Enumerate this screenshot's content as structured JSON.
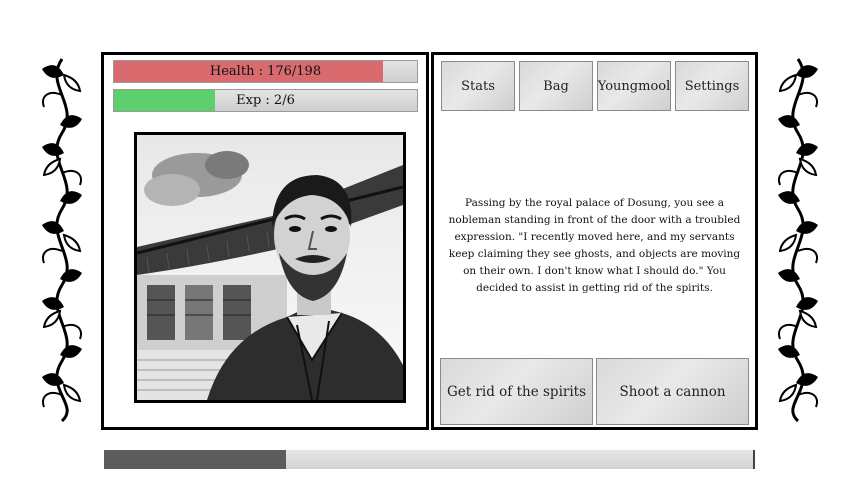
{
  "status": {
    "health_label": "Health : 176/198",
    "health_fraction": 0.889,
    "exp_label": "Exp : 2/6",
    "exp_fraction": 0.333
  },
  "menu": {
    "stats": "Stats",
    "bag": "Bag",
    "youngmool": "Youngmool",
    "settings": "Settings"
  },
  "story": {
    "text": "Passing by the royal palace of Dosung, you see a nobleman standing in front of the door with a troubled expression. \"I recently moved here, and my servants keep claiming they see ghosts, and objects are moving on their own. I don't know what I should do.\" You decided to assist in getting rid of the spirits."
  },
  "actions": {
    "option1": "Get rid of the spirits",
    "option2": "Shoot a cannon"
  },
  "progress": {
    "fraction": 0.28
  },
  "colors": {
    "health": "#d96b6e",
    "exp": "#5fcf6d",
    "progress": "#5c5c5c"
  },
  "icons": {
    "border_ornament": "vine-ornament",
    "portrait": "nobleman-portrait"
  }
}
